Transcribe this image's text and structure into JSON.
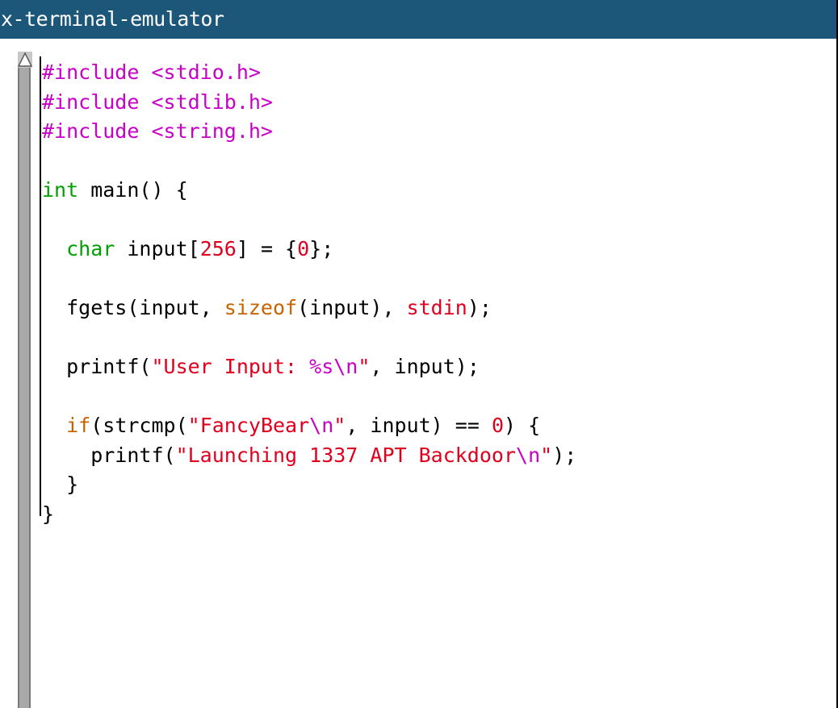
{
  "window": {
    "title": "x-terminal-emulator"
  },
  "editor": {
    "scrollbar_icon": "triangle-up-icon",
    "lines": [
      [
        {
          "t": "#include ",
          "c": "pp"
        },
        {
          "t": "<stdio.h>",
          "c": "pp"
        }
      ],
      [
        {
          "t": "#include ",
          "c": "pp"
        },
        {
          "t": "<stdlib.h>",
          "c": "pp"
        }
      ],
      [
        {
          "t": "#include ",
          "c": "pp"
        },
        {
          "t": "<string.h>",
          "c": "pp"
        }
      ],
      [],
      [
        {
          "t": "int",
          "c": "type"
        },
        {
          "t": " main() {",
          "c": "plain"
        }
      ],
      [],
      [
        {
          "t": "  ",
          "c": "plain"
        },
        {
          "t": "char",
          "c": "type"
        },
        {
          "t": " input[",
          "c": "plain"
        },
        {
          "t": "256",
          "c": "num"
        },
        {
          "t": "] = {",
          "c": "plain"
        },
        {
          "t": "0",
          "c": "num"
        },
        {
          "t": "};",
          "c": "plain"
        }
      ],
      [],
      [
        {
          "t": "  fgets(input, ",
          "c": "plain"
        },
        {
          "t": "sizeof",
          "c": "kw"
        },
        {
          "t": "(input), ",
          "c": "plain"
        },
        {
          "t": "stdin",
          "c": "std"
        },
        {
          "t": ");",
          "c": "plain"
        }
      ],
      [],
      [
        {
          "t": "  printf(",
          "c": "plain"
        },
        {
          "t": "\"User Input: ",
          "c": "str"
        },
        {
          "t": "%s",
          "c": "esc"
        },
        {
          "t": "\\n",
          "c": "esc"
        },
        {
          "t": "\"",
          "c": "str"
        },
        {
          "t": ", input);",
          "c": "plain"
        }
      ],
      [],
      [
        {
          "t": "  ",
          "c": "plain"
        },
        {
          "t": "if",
          "c": "kw"
        },
        {
          "t": "(strcmp(",
          "c": "plain"
        },
        {
          "t": "\"FancyBear",
          "c": "str"
        },
        {
          "t": "\\n",
          "c": "esc"
        },
        {
          "t": "\"",
          "c": "str"
        },
        {
          "t": ", input) == ",
          "c": "plain"
        },
        {
          "t": "0",
          "c": "num"
        },
        {
          "t": ") {",
          "c": "plain"
        }
      ],
      [
        {
          "t": "    printf(",
          "c": "plain"
        },
        {
          "t": "\"Launching 1337 APT Backdoor",
          "c": "str"
        },
        {
          "t": "\\n",
          "c": "esc"
        },
        {
          "t": "\"",
          "c": "str"
        },
        {
          "t": ");",
          "c": "plain"
        }
      ],
      [
        {
          "t": "  }",
          "c": "plain"
        }
      ],
      [
        {
          "t": "}",
          "c": "plain"
        }
      ]
    ]
  }
}
